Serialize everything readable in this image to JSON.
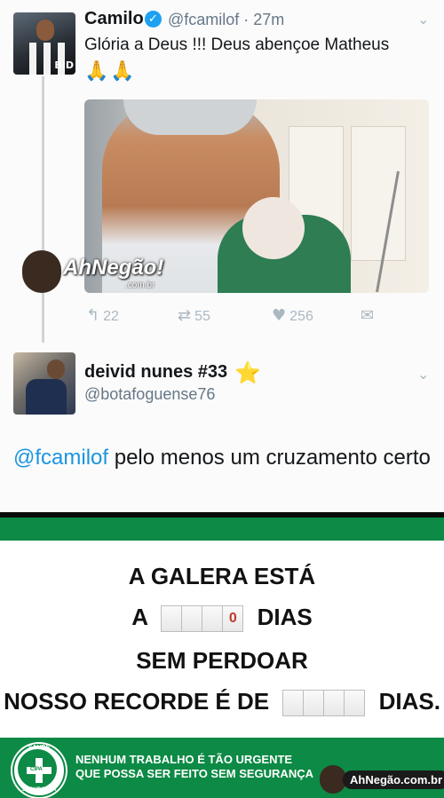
{
  "tweet": {
    "author_name": "Camilo",
    "verified_icon": "✓",
    "handle_time": "@fcamilof · 27m",
    "text": "Glória a Deus !!! Deus abençoe Matheus",
    "emoji": "🙏🙏",
    "avatar_caption": "BID",
    "actions": {
      "replies": "22",
      "retweets": "55",
      "likes": "256"
    }
  },
  "watermark": {
    "brand": "AhNegão!",
    "domain": ".com.br"
  },
  "reply": {
    "author_name": "deivid nunes #33",
    "star": "⭐",
    "handle": "@botafoguense76",
    "mention": "@fcamilof",
    "text": " pelo menos um cruzamento certo"
  },
  "sign": {
    "line1": "A GALERA ESTÁ",
    "line2_prefix": "A",
    "line2_counter_last": "0",
    "line2_suffix": "DIAS",
    "line3": "SEM PERDOAR",
    "line4_prefix": "NOSSO RECORDE É DE",
    "line4_suffix": "DIAS.",
    "cipa_top": "SAÚDE",
    "cipa_center": "CIPA",
    "cipa_bottom": "SEGURANÇA",
    "footer_line1": "NENHUM TRABALHO É TÃO URGENTE",
    "footer_line2": "QUE POSSA SER FEITO SEM SEGURANÇA",
    "badge": "AhNegão.com.br"
  },
  "colors": {
    "twitter_blue": "#1da1f2",
    "sign_green": "#0d8a45"
  }
}
